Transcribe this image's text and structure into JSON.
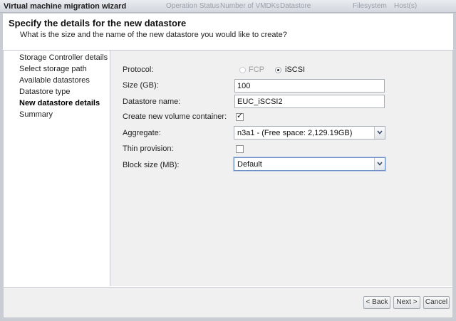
{
  "window": {
    "title": "Virtual machine migration wizard",
    "background_columns": [
      "Operation Status",
      "Number of VMDKs",
      "Datastore",
      "Filesystem",
      "Host(s)"
    ]
  },
  "header": {
    "title": "Specify the details for the new datastore",
    "subtitle": "What is the size and the name of the new datastore you would like to create?"
  },
  "steps": [
    {
      "label": "Storage Controller details",
      "active": false
    },
    {
      "label": "Select storage path",
      "active": false
    },
    {
      "label": "Available datastores",
      "active": false
    },
    {
      "label": "Datastore type",
      "active": false
    },
    {
      "label": "New datastore details",
      "active": true
    },
    {
      "label": "Summary",
      "active": false
    }
  ],
  "form": {
    "protocol_label": "Protocol:",
    "protocol_options": [
      {
        "label": "FCP",
        "selected": false,
        "enabled": false
      },
      {
        "label": "iSCSI",
        "selected": true,
        "enabled": true
      }
    ],
    "size_label": "Size (GB):",
    "size_value": "100",
    "name_label": "Datastore name:",
    "name_value": "EUC_iSCSI2",
    "volume_container_label": "Create new volume container:",
    "volume_container_checked": true,
    "aggregate_label": "Aggregate:",
    "aggregate_value": "n3a1 - (Free space: 2,129.19GB)",
    "thin_label": "Thin provision:",
    "thin_checked": false,
    "block_label": "Block size (MB):",
    "block_value": "Default"
  },
  "buttons": {
    "back": "< Back",
    "next": "Next >",
    "cancel": "Cancel"
  },
  "icons": {
    "check": "check-icon",
    "dropdown": "chevron-down-icon"
  }
}
